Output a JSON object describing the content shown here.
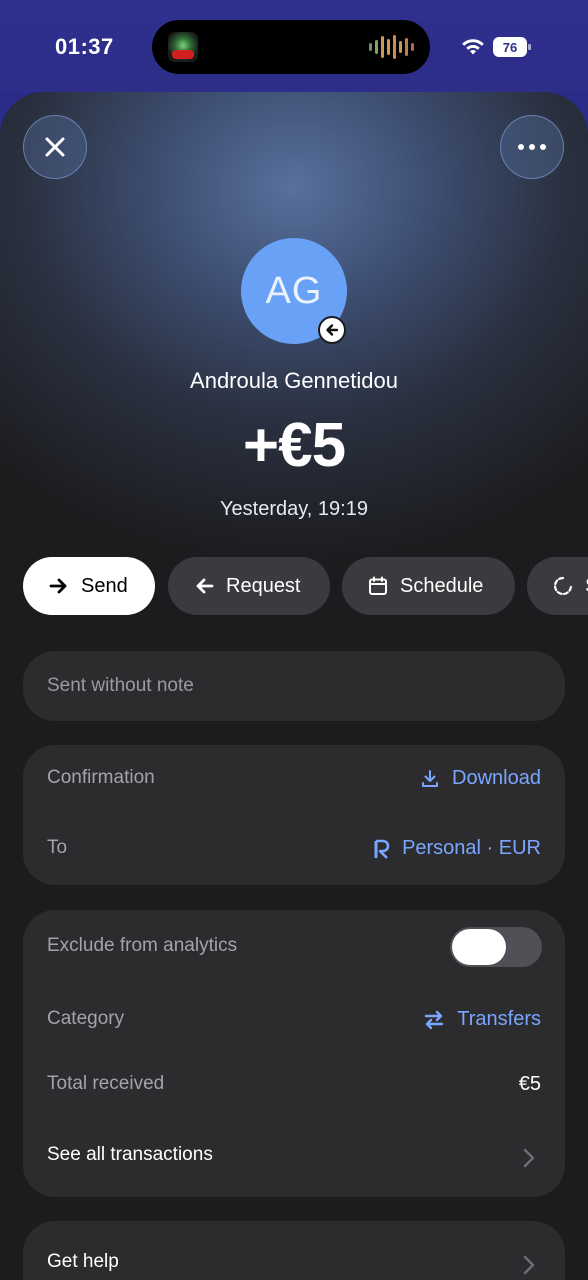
{
  "status_bar": {
    "time": "01:37",
    "battery": "76"
  },
  "header": {
    "close_icon": "close-icon",
    "more_icon": "more-horizontal-icon"
  },
  "transaction": {
    "avatar_initials": "AG",
    "avatar_color": "#69a1f7",
    "counterparty": "Androula Gennetidou",
    "amount": "+€5",
    "date": "Yesterday, 19:19"
  },
  "actions": [
    {
      "label": "Send",
      "icon": "arrow-right-icon"
    },
    {
      "label": "Request",
      "icon": "arrow-left-icon"
    },
    {
      "label": "Schedule",
      "icon": "calendar-icon"
    },
    {
      "label": "S",
      "icon": "refresh-icon"
    }
  ],
  "note": {
    "text": "Sent without note"
  },
  "details": {
    "confirmation_label": "Confirmation",
    "download_label": "Download",
    "to_label": "To",
    "to_value": "Personal · EUR"
  },
  "analytics": {
    "exclude_label": "Exclude from analytics",
    "exclude_enabled": false,
    "category_label": "Category",
    "category_value": "Transfers",
    "total_label": "Total received",
    "total_value": "€5",
    "see_all_label": "See all transactions"
  },
  "help": {
    "label": "Get help"
  },
  "colors": {
    "accent": "#7aa6ff",
    "background": "#1c1c1e",
    "card": "#2c2c2e"
  }
}
